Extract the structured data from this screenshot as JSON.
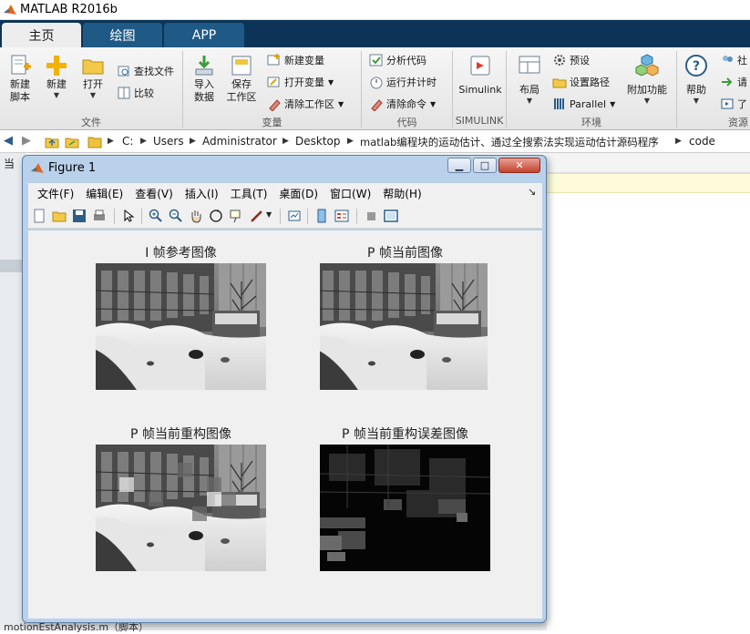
{
  "app": {
    "title": "MATLAB R2016b"
  },
  "tabs": [
    {
      "label": "主页",
      "active": true
    },
    {
      "label": "绘图",
      "active": false
    },
    {
      "label": "APP",
      "active": false
    }
  ],
  "ribbon": {
    "file": {
      "group_label": "文件",
      "new_script": [
        "新建",
        "脚本"
      ],
      "new": "新建",
      "open": "打开",
      "find_files": "查找文件",
      "compare": "比较"
    },
    "variable": {
      "group_label": "变量",
      "import": [
        "导入",
        "数据"
      ],
      "save": [
        "保存",
        "工作区"
      ],
      "new_variable": "新建变量",
      "open_variable": "打开变量",
      "clear_workspace": "清除工作区"
    },
    "code": {
      "group_label": "代码",
      "analyze": "分析代码",
      "run_time": "运行并计时",
      "clear_commands": "清除命令"
    },
    "simulink": {
      "group_label": "SIMULINK",
      "simulink": "Simulink"
    },
    "environment": {
      "group_label": "环境",
      "layout": "布局",
      "preferences": "预设",
      "set_path": "设置路径",
      "parallel": "Parallel",
      "addons": "附加功能"
    },
    "resources": {
      "group_label": "资源",
      "help": "帮助",
      "community": "社",
      "request": "请",
      "learn": "了"
    }
  },
  "address": {
    "crumbs": [
      "C:",
      "Users",
      "Administrator",
      "Desktop",
      "matlab编程块的运动估计、通过全搜索法实现运动估计源码程序",
      "code"
    ]
  },
  "background": {
    "current_folder_label": "当",
    "bottom_file": "motionEstAnalysis.m（脚本）"
  },
  "figure": {
    "title": "Figure 1",
    "menus": [
      {
        "label": "文件(F)"
      },
      {
        "label": "编辑(E)"
      },
      {
        "label": "查看(V)"
      },
      {
        "label": "插入(I)"
      },
      {
        "label": "工具(T)"
      },
      {
        "label": "桌面(D)"
      },
      {
        "label": "窗口(W)"
      },
      {
        "label": "帮助(H)"
      }
    ],
    "axes": [
      {
        "title": "I 帧参考图像"
      },
      {
        "title": "P 帧当前图像"
      },
      {
        "title": "P 帧当前重构图像"
      },
      {
        "title": "P 帧当前重构误差图像"
      }
    ]
  },
  "colors": {
    "tab_bar": "#0d3456",
    "tab_inactive": "#1f5a86",
    "ribbon": "#ececec",
    "figure_frame": "#b9d1ea",
    "canvas": "#f0f0f0"
  }
}
